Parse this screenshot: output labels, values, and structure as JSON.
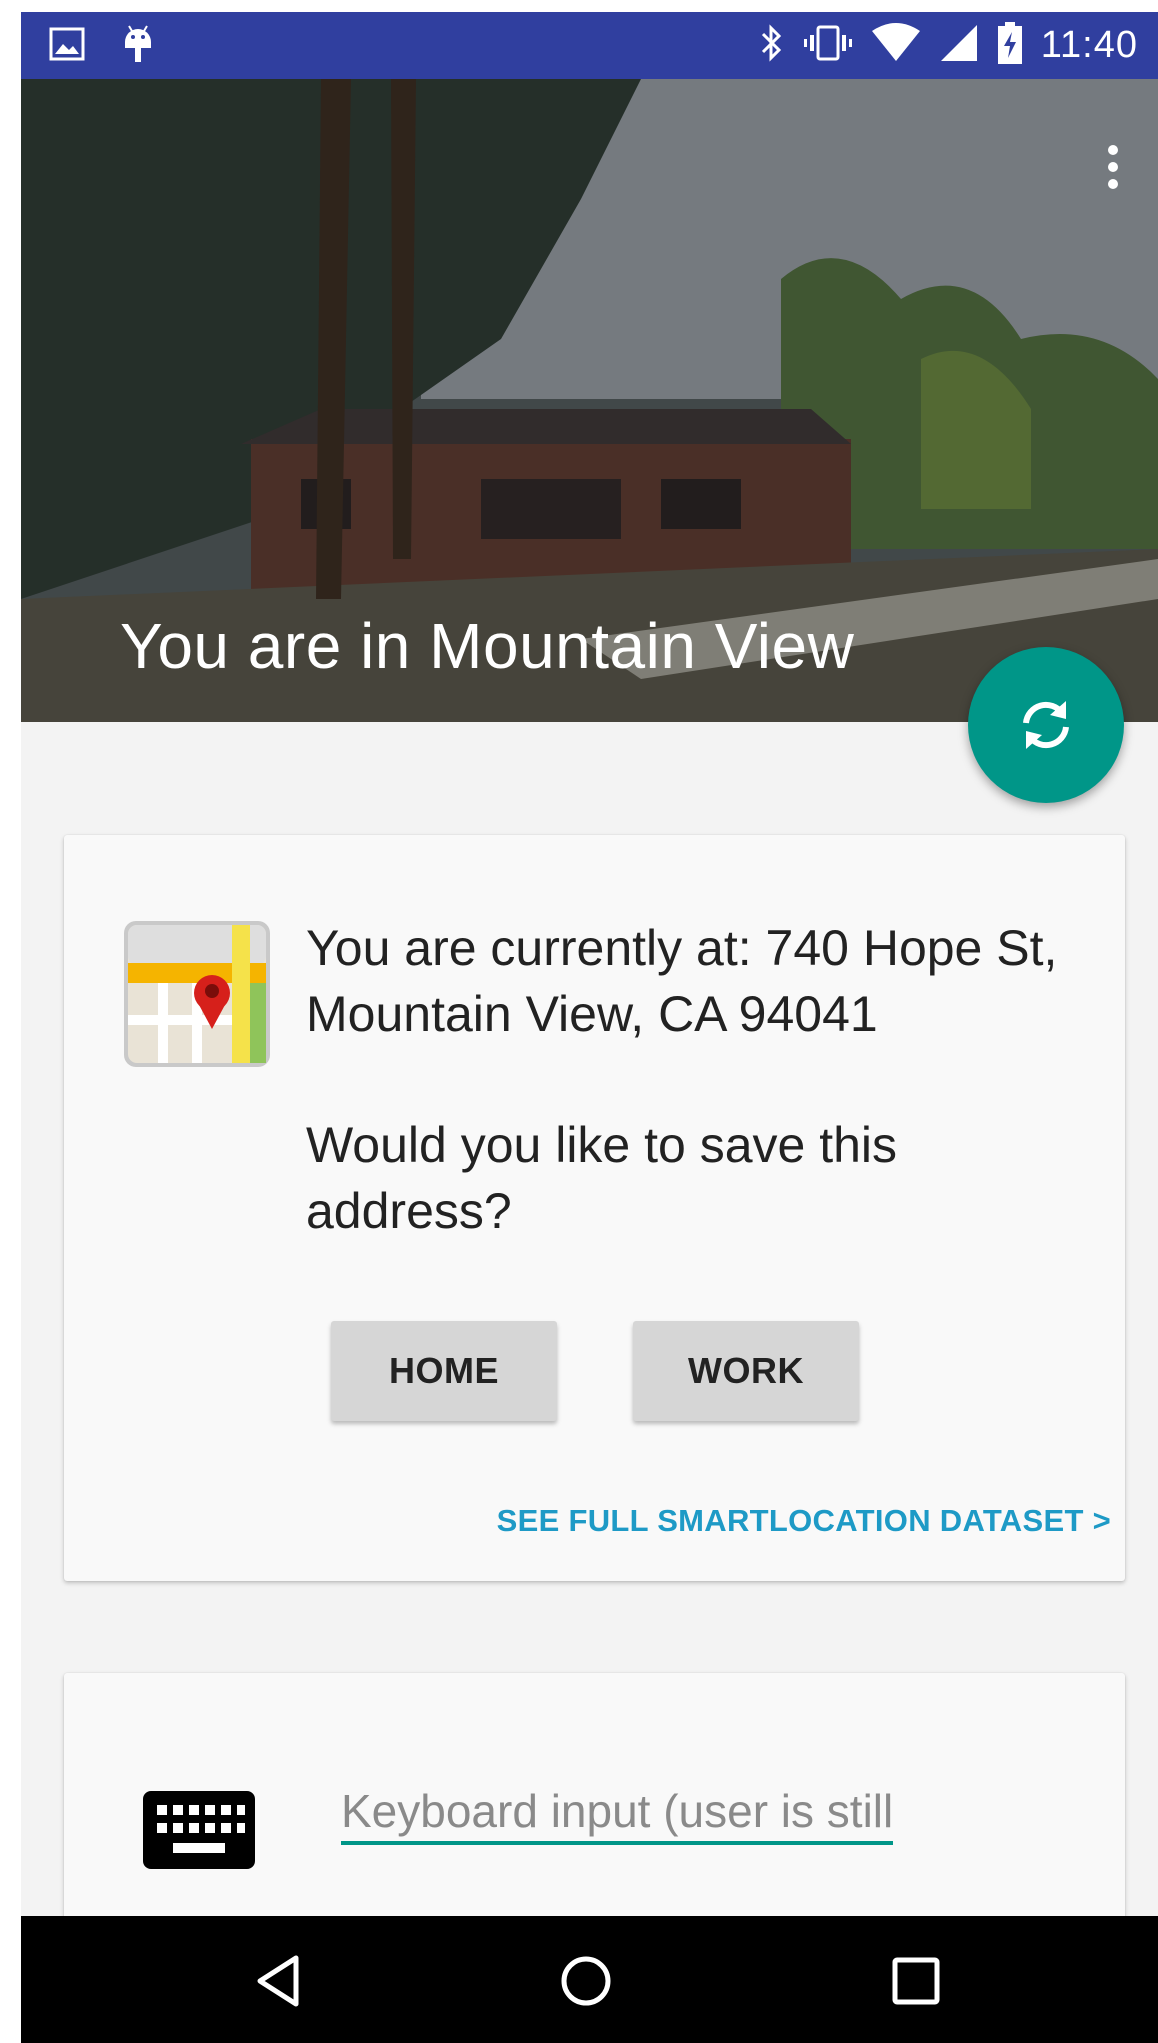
{
  "status_bar": {
    "time": "11:40",
    "left_icons": [
      "image-icon",
      "android-debug-icon"
    ],
    "right_icons": [
      "bluetooth-icon",
      "vibrate-icon",
      "wifi-icon",
      "cell-signal-icon",
      "battery-charging-icon"
    ]
  },
  "hero": {
    "title": "You are in Mountain View"
  },
  "location_card": {
    "address_text": "You are currently at: 740 Hope St, Mountain View, CA 94041",
    "question": "Would you like to save this address?",
    "home_label": "HOME",
    "work_label": "WORK",
    "dataset_link": "SEE FULL SMARTLOCATION DATASET >"
  },
  "keyboard_card": {
    "input_value": "Keyboard input (user is still)"
  },
  "colors": {
    "status_bar": "#303f9f",
    "accent": "#009688",
    "link": "#1e9ac6"
  }
}
